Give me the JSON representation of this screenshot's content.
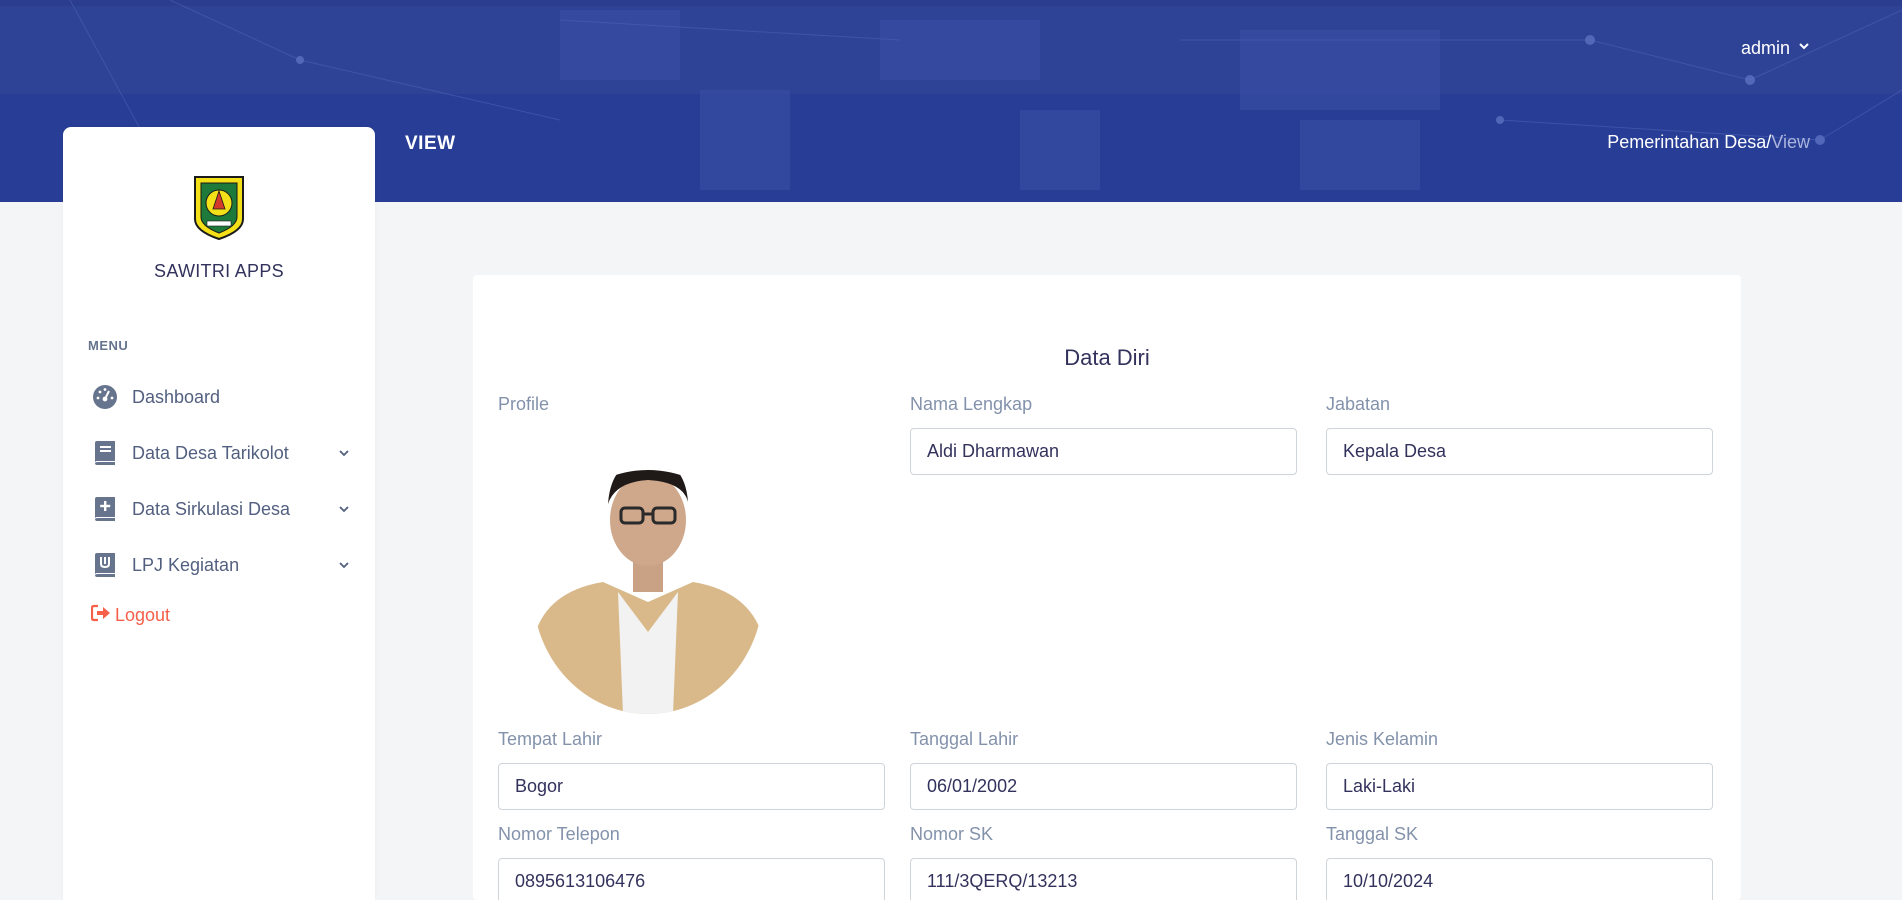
{
  "header": {
    "user_label": "admin",
    "page_title": "VIEW",
    "breadcrumb": {
      "parent": "Pemerintahan Desa",
      "separator": "/",
      "current": "View"
    }
  },
  "sidebar": {
    "app_name": "SAWITRI APPS",
    "menu_heading": "MENU",
    "items": [
      {
        "label": "Dashboard",
        "icon": "dashboard-icon",
        "has_submenu": false
      },
      {
        "label": "Data Desa Tarikolot",
        "icon": "book-icon",
        "has_submenu": true
      },
      {
        "label": "Data Sirkulasi Desa",
        "icon": "book-plus-icon",
        "has_submenu": true
      },
      {
        "label": "LPJ Kegiatan",
        "icon": "book-hand-icon",
        "has_submenu": true
      }
    ],
    "logout_label": "Logout"
  },
  "form": {
    "title": "Data Diri",
    "profile_label": "Profile",
    "nama_lengkap": {
      "label": "Nama Lengkap",
      "value": "Aldi Dharmawan"
    },
    "jabatan": {
      "label": "Jabatan",
      "value": "Kepala Desa"
    },
    "tempat_lahir": {
      "label": "Tempat Lahir",
      "value": "Bogor"
    },
    "tanggal_lahir": {
      "label": "Tanggal Lahir",
      "value": "06/01/2002"
    },
    "jenis_kelamin": {
      "label": "Jenis Kelamin",
      "value": "Laki-Laki"
    },
    "nomor_telepon": {
      "label": "Nomor Telepon",
      "value": "0895613106476"
    },
    "nomor_sk": {
      "label": "Nomor SK",
      "value": "111/3QERQ/13213"
    },
    "tanggal_sk": {
      "label": "Tanggal SK",
      "value": "10/10/2024"
    }
  },
  "colors": {
    "header_blue": "#283e96",
    "topbar_blue": "#2f4396",
    "logout_red": "#f5604a",
    "label_gray": "#8392ab",
    "page_bg": "#f4f5f7"
  }
}
